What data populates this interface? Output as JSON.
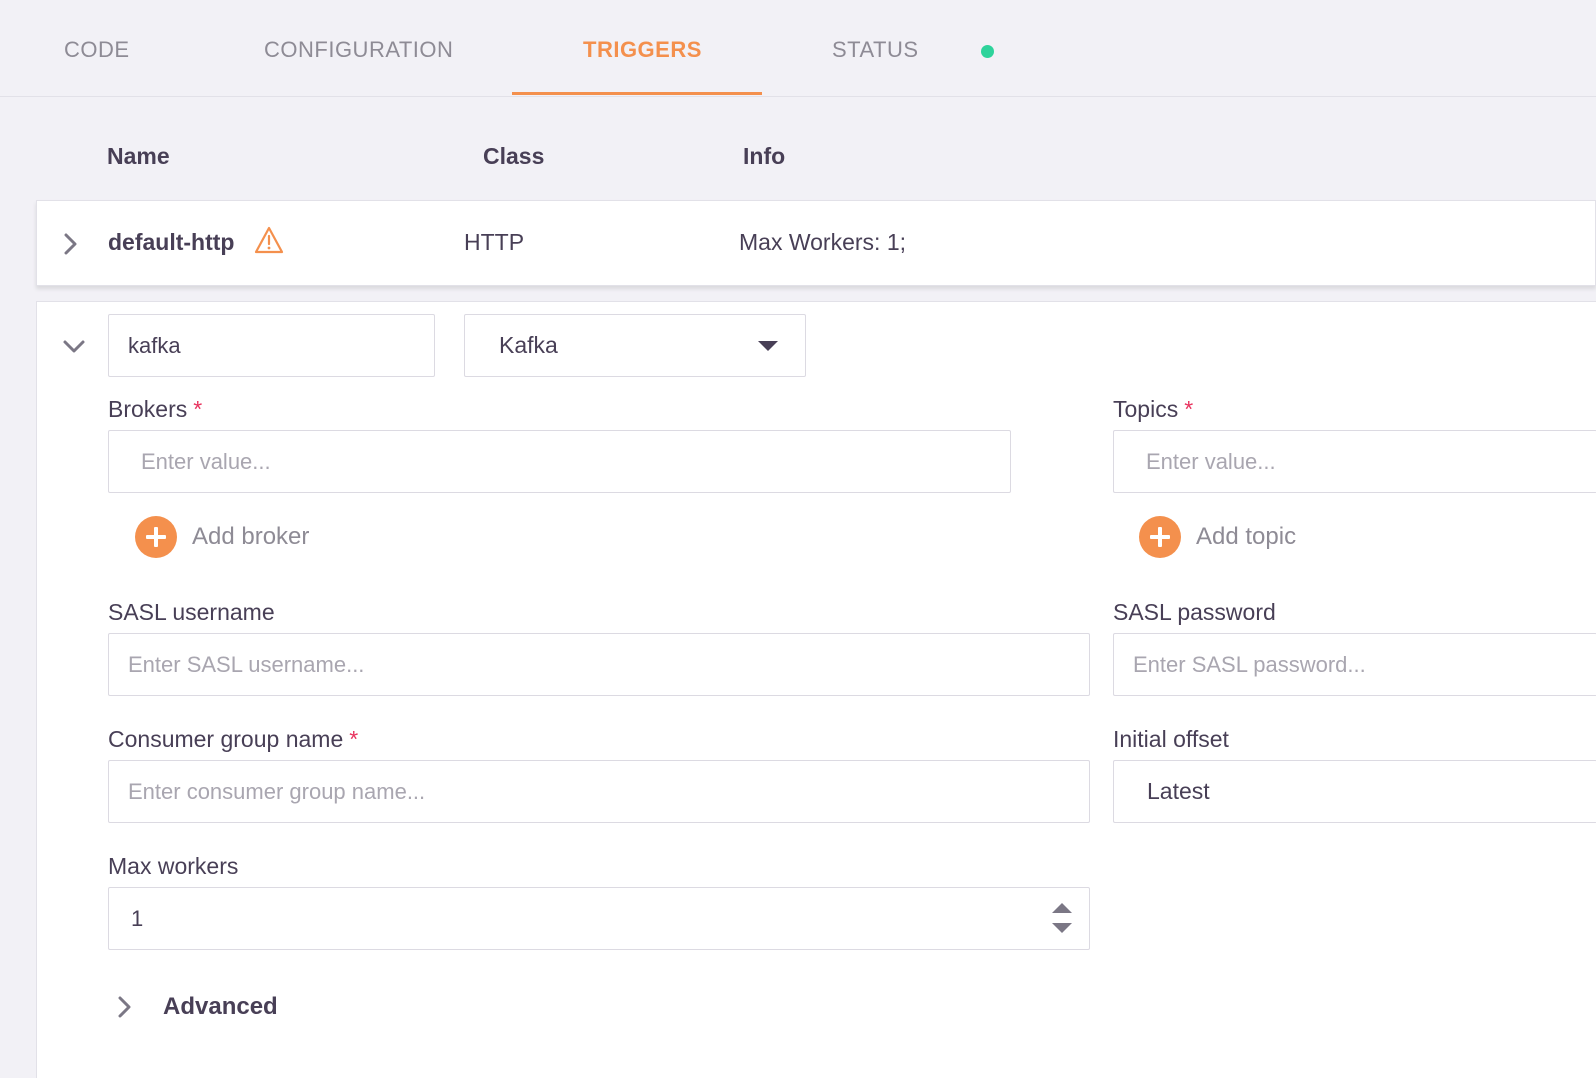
{
  "tabs": [
    {
      "label": "CODE"
    },
    {
      "label": "CONFIGURATION"
    },
    {
      "label": "TRIGGERS"
    },
    {
      "label": "STATUS"
    }
  ],
  "active_tab": "TRIGGERS",
  "status_color": "#2ed39b",
  "accent_color": "#f4904d",
  "table": {
    "headers": {
      "name": "Name",
      "class": "Class",
      "info": "Info"
    }
  },
  "triggers": [
    {
      "name": "default-http",
      "warning_icon": "warning-triangle-icon",
      "class": "HTTP",
      "info": "Max Workers: 1;"
    }
  ],
  "expanded_trigger": {
    "name_value": "kafka",
    "class_value": "Kafka",
    "brokers": {
      "label": "Brokers",
      "required_mark": "*",
      "placeholder": "Enter value...",
      "add_label": "Add broker"
    },
    "topics": {
      "label": "Topics",
      "required_mark": "*",
      "placeholder": "Enter value...",
      "add_label": "Add topic"
    },
    "sasl_username": {
      "label": "SASL username",
      "placeholder": "Enter SASL username..."
    },
    "sasl_password": {
      "label": "SASL password",
      "placeholder": "Enter SASL password..."
    },
    "consumer_group": {
      "label": "Consumer group name",
      "required_mark": "*",
      "placeholder": "Enter consumer group name..."
    },
    "initial_offset": {
      "label": "Initial offset",
      "value": "Latest"
    },
    "max_workers": {
      "label": "Max workers",
      "value": "1"
    },
    "advanced": {
      "label": "Advanced"
    }
  }
}
